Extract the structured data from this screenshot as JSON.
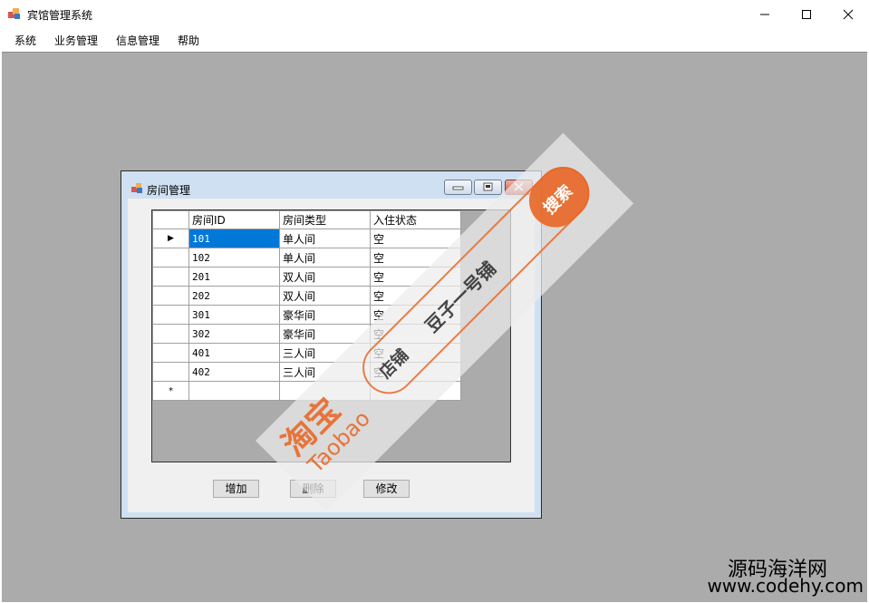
{
  "window": {
    "title": "宾馆管理系统"
  },
  "menu": [
    {
      "label": "系统"
    },
    {
      "label": "业务管理"
    },
    {
      "label": "信息管理"
    },
    {
      "label": "帮助"
    }
  ],
  "child": {
    "title": "房间管理",
    "columns": [
      "房间ID",
      "房间类型",
      "入住状态"
    ],
    "rows": [
      {
        "id": "101",
        "type": "单人间",
        "status": "空"
      },
      {
        "id": "102",
        "type": "单人间",
        "status": "空"
      },
      {
        "id": "201",
        "type": "双人间",
        "status": "空"
      },
      {
        "id": "202",
        "type": "双人间",
        "status": "空"
      },
      {
        "id": "301",
        "type": "豪华间",
        "status": "空"
      },
      {
        "id": "302",
        "type": "豪华间",
        "status": "空"
      },
      {
        "id": "401",
        "type": "三人间",
        "status": "空"
      },
      {
        "id": "402",
        "type": "三人间",
        "status": "空"
      }
    ],
    "new_row_marker": "*",
    "current_row_marker": "▶",
    "buttons": {
      "add": "增加",
      "delete": "删除",
      "edit": "修改"
    }
  },
  "watermark": {
    "brand": "淘宝",
    "brand_latin": "Taobao",
    "shop_label": "店铺",
    "shop_name": "豆子一号铺",
    "search": "搜索"
  },
  "corner_watermark": {
    "line1": "源码海洋网",
    "line2": "www.codehy.com"
  }
}
